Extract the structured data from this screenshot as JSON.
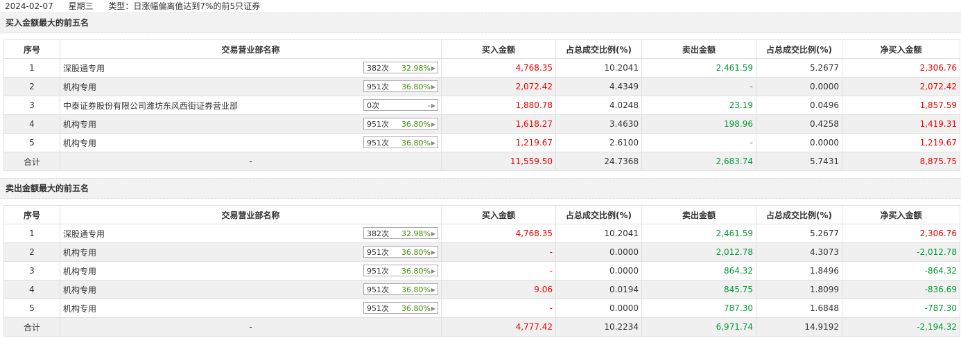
{
  "header": {
    "date": "2024-02-07",
    "weekday": "星期三",
    "type_label": "类型：日涨幅偏离值达到7%的前5只证券"
  },
  "columns": [
    "序号",
    "交易营业部名称",
    "买入金额",
    "占总成交比例(%)",
    "卖出金额",
    "占总成交比例(%)",
    "净买入金额"
  ],
  "buy_top5": {
    "title": "买入金额最大的前五名",
    "rows": [
      {
        "idx": "1",
        "name": "深股通专用",
        "times": "382次",
        "pct": "32.98%",
        "buy": "4,768.35",
        "buy_ratio": "10.2041",
        "sell": "2,461.59",
        "sell_ratio": "5.2677",
        "net": "2,306.76"
      },
      {
        "idx": "2",
        "name": "机构专用",
        "times": "951次",
        "pct": "36.80%",
        "buy": "2,072.42",
        "buy_ratio": "4.4349",
        "sell": "-",
        "sell_ratio": "0.0000",
        "net": "2,072.42"
      },
      {
        "idx": "3",
        "name": "中泰证券股份有限公司潍坊东风西街证券营业部",
        "times": "0次",
        "pct": "-",
        "buy": "1,880.78",
        "buy_ratio": "4.0248",
        "sell": "23.19",
        "sell_ratio": "0.0496",
        "net": "1,857.59"
      },
      {
        "idx": "4",
        "name": "机构专用",
        "times": "951次",
        "pct": "36.80%",
        "buy": "1,618.27",
        "buy_ratio": "3.4630",
        "sell": "198.96",
        "sell_ratio": "0.4258",
        "net": "1,419.31"
      },
      {
        "idx": "5",
        "name": "机构专用",
        "times": "951次",
        "pct": "36.80%",
        "buy": "1,219.67",
        "buy_ratio": "2.6100",
        "sell": "-",
        "sell_ratio": "0.0000",
        "net": "1,219.67"
      }
    ],
    "total": {
      "label": "合计",
      "name": "-",
      "buy": "11,559.50",
      "buy_ratio": "24.7368",
      "sell": "2,683.74",
      "sell_ratio": "5.7431",
      "net": "8,875.75"
    }
  },
  "sell_top5": {
    "title": "卖出金额最大的前五名",
    "rows": [
      {
        "idx": "1",
        "name": "深股通专用",
        "times": "382次",
        "pct": "32.98%",
        "buy": "4,768.35",
        "buy_ratio": "10.2041",
        "sell": "2,461.59",
        "sell_ratio": "5.2677",
        "net": "2,306.76"
      },
      {
        "idx": "2",
        "name": "机构专用",
        "times": "951次",
        "pct": "36.80%",
        "buy": "-",
        "buy_ratio": "0.0000",
        "sell": "2,012.78",
        "sell_ratio": "4.3073",
        "net": "-2,012.78"
      },
      {
        "idx": "3",
        "name": "机构专用",
        "times": "951次",
        "pct": "36.80%",
        "buy": "-",
        "buy_ratio": "0.0000",
        "sell": "864.32",
        "sell_ratio": "1.8496",
        "net": "-864.32"
      },
      {
        "idx": "4",
        "name": "机构专用",
        "times": "951次",
        "pct": "36.80%",
        "buy": "9.06",
        "buy_ratio": "0.0194",
        "sell": "845.75",
        "sell_ratio": "1.8099",
        "net": "-836.69"
      },
      {
        "idx": "5",
        "name": "机构专用",
        "times": "951次",
        "pct": "36.80%",
        "buy": "-",
        "buy_ratio": "0.0000",
        "sell": "787.30",
        "sell_ratio": "1.6848",
        "net": "-787.30"
      }
    ],
    "total": {
      "label": "合计",
      "name": "-",
      "buy": "4,777.42",
      "buy_ratio": "10.2234",
      "sell": "6,971.74",
      "sell_ratio": "14.9192",
      "net": "-2,194.32"
    }
  },
  "colors": {
    "buy": "#ee0000",
    "sell": "#009933",
    "badge_pct": "#3a8e00"
  },
  "icons": {
    "badge_arrow": "caret-right-icon"
  }
}
